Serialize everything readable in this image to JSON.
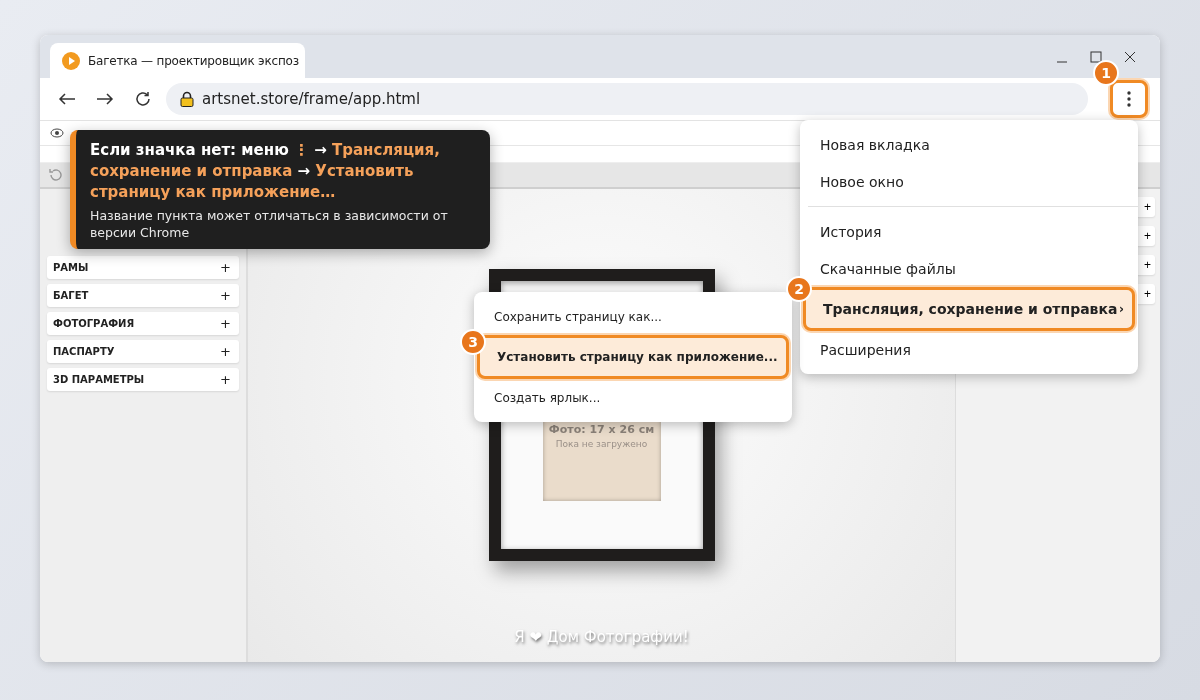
{
  "browser": {
    "tab": {
      "title": "Багетка — проектировщик экспоз"
    },
    "address": "artsnet.store/frame/app.html",
    "menu_button": {
      "step": "1",
      "highlighted": true
    }
  },
  "page": {
    "sidebar": {
      "sections": [
        {
          "label": "РАМЫ",
          "toggle": "+"
        },
        {
          "label": "БАГЕТ",
          "toggle": "+"
        },
        {
          "label": "ФОТОГРАФИЯ",
          "toggle": "+"
        },
        {
          "label": "ПАСПАРТУ",
          "toggle": "+"
        },
        {
          "label": "3D ПАРАМЕТРЫ",
          "toggle": "+"
        }
      ]
    },
    "canvas": {
      "photo_label": "Фото: 17 x 26 см",
      "photo_status": "Пока не загружено",
      "footer": "Я ❤ Дом Фотографии!"
    },
    "right_panel": {
      "buttons": [
        "+",
        "+",
        "+",
        "+"
      ]
    }
  },
  "hint": {
    "title": "Если значка нет: меню **⋮** → **Трансляция, сохранение и отправка** → **Установить страницу как приложение…**",
    "note": "Название пункта может отличаться в зависимости от версии Chrome"
  },
  "menu": {
    "items": [
      {
        "kind": "item",
        "label": "Новая вкладка",
        "highlighted": false
      },
      {
        "kind": "item",
        "label": "Новое окно",
        "highlighted": false
      },
      {
        "kind": "separator"
      },
      {
        "kind": "item",
        "label": "История",
        "highlighted": false
      },
      {
        "kind": "item",
        "label": "Скачанные файлы",
        "highlighted": false
      },
      {
        "kind": "item",
        "label": "Трансляция, сохранение и отправка",
        "highlighted": true,
        "step": "2",
        "arrow": "›"
      },
      {
        "kind": "item",
        "label": "Расширения",
        "highlighted": false
      }
    ]
  },
  "submenu": {
    "items": [
      {
        "label": "Сохранить страницу как...",
        "highlighted": false
      },
      {
        "label": "Установить страницу как приложение...",
        "highlighted": true,
        "step": "3"
      },
      {
        "label": "Создать ярлык...",
        "highlighted": false
      }
    ]
  }
}
